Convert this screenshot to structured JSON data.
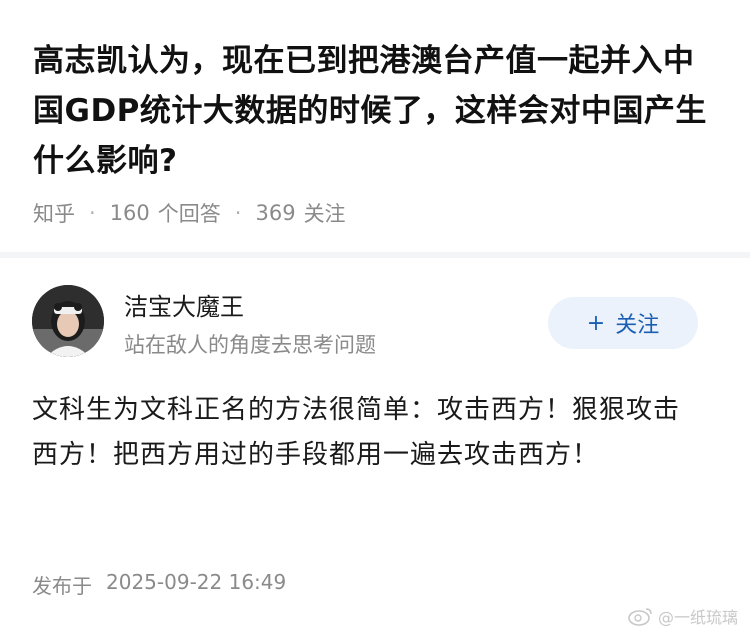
{
  "question": {
    "title": "高志凯认为，现在已到把港澳台产值一起并入中国GDP统计大数据的时候了，这样会对中国产生什么影响?",
    "source": "知乎",
    "answers_count": "160",
    "answers_label": "个回答",
    "followers_count": "369",
    "followers_label": "关注"
  },
  "answer": {
    "author_name": "洁宝大魔王",
    "author_bio": "站在敌人的角度去思考问题",
    "follow_label": "关注",
    "content": "文科生为文科正名的方法很简单：攻击西方！狠狠攻击西方！把西方用过的手段都用一遍去攻击西方！",
    "published_label": "发布于",
    "published_time": "2025-09-22 16:49"
  },
  "watermark": {
    "text": "@一纸琉璃"
  },
  "colors": {
    "accent": "#1a5fb4",
    "follow_bg": "#ebf2fb",
    "meta_text": "#8a8a8a"
  }
}
